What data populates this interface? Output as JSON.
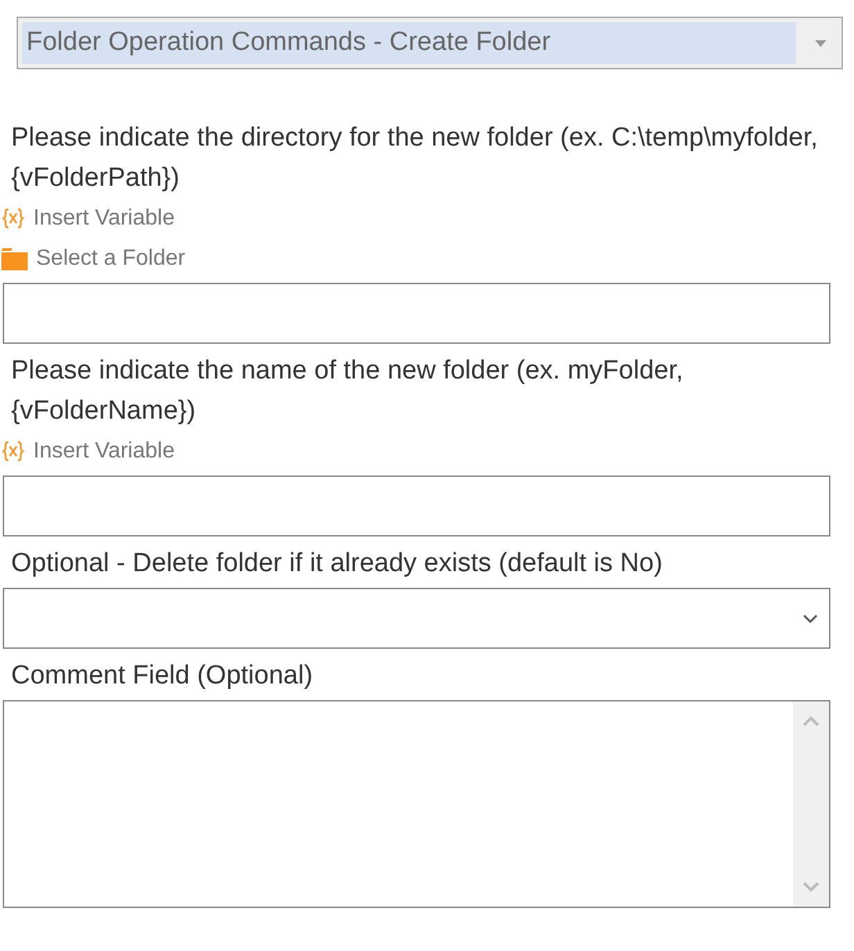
{
  "command_dropdown": {
    "value": "Folder Operation Commands - Create Folder"
  },
  "fields": [
    {
      "kind": "text",
      "label": "Please indicate the directory for the new folder (ex. C:\\temp\\myfolder, {vFolderPath})",
      "links": [
        {
          "kind": "variable",
          "label": "Insert Variable"
        },
        {
          "kind": "folder",
          "label": "Select a Folder"
        }
      ]
    },
    {
      "kind": "text",
      "label": "Please indicate the name of the new folder (ex. myFolder, {vFolderName})",
      "links": [
        {
          "kind": "variable",
          "label": "Insert Variable"
        }
      ]
    },
    {
      "kind": "select",
      "label": "Optional - Delete folder if it already exists (default is No)"
    },
    {
      "kind": "textarea",
      "label": "Comment Field (Optional)"
    }
  ]
}
